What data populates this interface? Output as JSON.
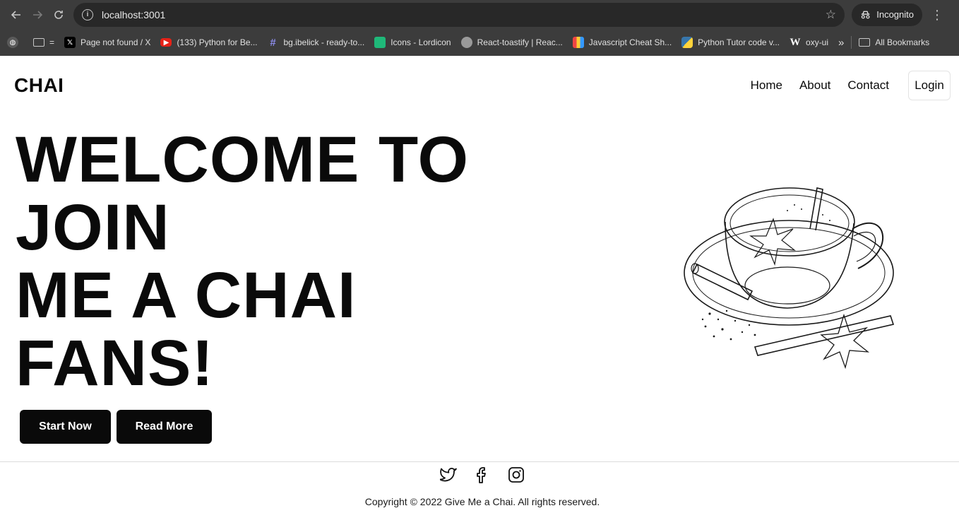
{
  "browser": {
    "url": "localhost:3001",
    "profile_label": "Incognito",
    "bookmarks": [
      {
        "label": "Page not found / X",
        "icon": "x-icon"
      },
      {
        "label": "(133) Python for Be...",
        "icon": "youtube-icon"
      },
      {
        "label": "bg.ibelick - ready-to...",
        "icon": "hash-icon"
      },
      {
        "label": "Icons - Lordicon",
        "icon": "lordicon-icon"
      },
      {
        "label": "React-toastify | Reac...",
        "icon": "toastify-icon"
      },
      {
        "label": "Javascript Cheat Sh...",
        "icon": "cheatsheet-icon"
      },
      {
        "label": "Python Tutor code v...",
        "icon": "python-icon"
      },
      {
        "label": "oxy-ui",
        "icon": "w-icon"
      }
    ],
    "all_bookmarks_label": "All Bookmarks",
    "folder_label": "=",
    "overflow_label": "»"
  },
  "site": {
    "logo": "CHAI",
    "nav": {
      "home": "Home",
      "about": "About",
      "contact": "Contact",
      "login": "Login"
    },
    "hero": {
      "line1": "WELCOME TO",
      "line2": "JOIN",
      "line3": "ME A CHAI",
      "line4": "FANS!"
    },
    "buttons": {
      "start": "Start Now",
      "read": "Read More"
    },
    "footer": {
      "copyright": "Copyright © 2022 Give Me a Chai. All rights reserved.",
      "socials": [
        "twitter-icon",
        "facebook-icon",
        "instagram-icon"
      ]
    }
  },
  "colors": {
    "chrome_bg": "#3c3c3c",
    "omnibox_bg": "#282828",
    "text_dark": "#0a0a0a",
    "button_bg": "#0a0a0a",
    "button_text": "#ffffff"
  }
}
